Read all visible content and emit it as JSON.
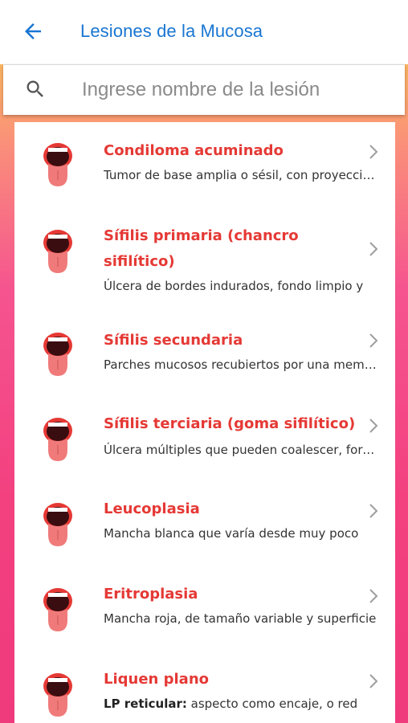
{
  "header": {
    "title": "Lesiones de la Mucosa",
    "back_icon": "arrow-left-icon"
  },
  "search": {
    "placeholder": "Ingrese nombre de la lesión",
    "value": "",
    "icon": "search-icon"
  },
  "colors": {
    "accent_blue": "#1976d2",
    "title_red": "#e53935",
    "gradient_top": "#fbd24c",
    "gradient_bottom": "#ef3a7c"
  },
  "lesions": [
    {
      "title": "Condiloma acuminado",
      "desc": "Tumor de base amplia o sésil, con proyecciones"
    },
    {
      "title": "Sífilis primaria (chancro sifilítico)",
      "desc": "Úlcera de bordes indurados, fondo limpio y"
    },
    {
      "title": "Sífilis secundaria",
      "desc": "Parches mucosos recubiertos por una membrana"
    },
    {
      "title": "Sífilis terciaria (goma sifilítico)",
      "desc": "Úlcera múltiples que pueden coalescer, formando"
    },
    {
      "title": "Leucoplasia",
      "desc": "Mancha blanca que varía desde muy poco"
    },
    {
      "title": "Eritroplasia",
      "desc": "Mancha roja, de tamaño variable y superficie"
    },
    {
      "title": "Liquen plano",
      "desc_bold": "LP reticular:",
      "desc": " aspecto como encaje, o red"
    }
  ]
}
